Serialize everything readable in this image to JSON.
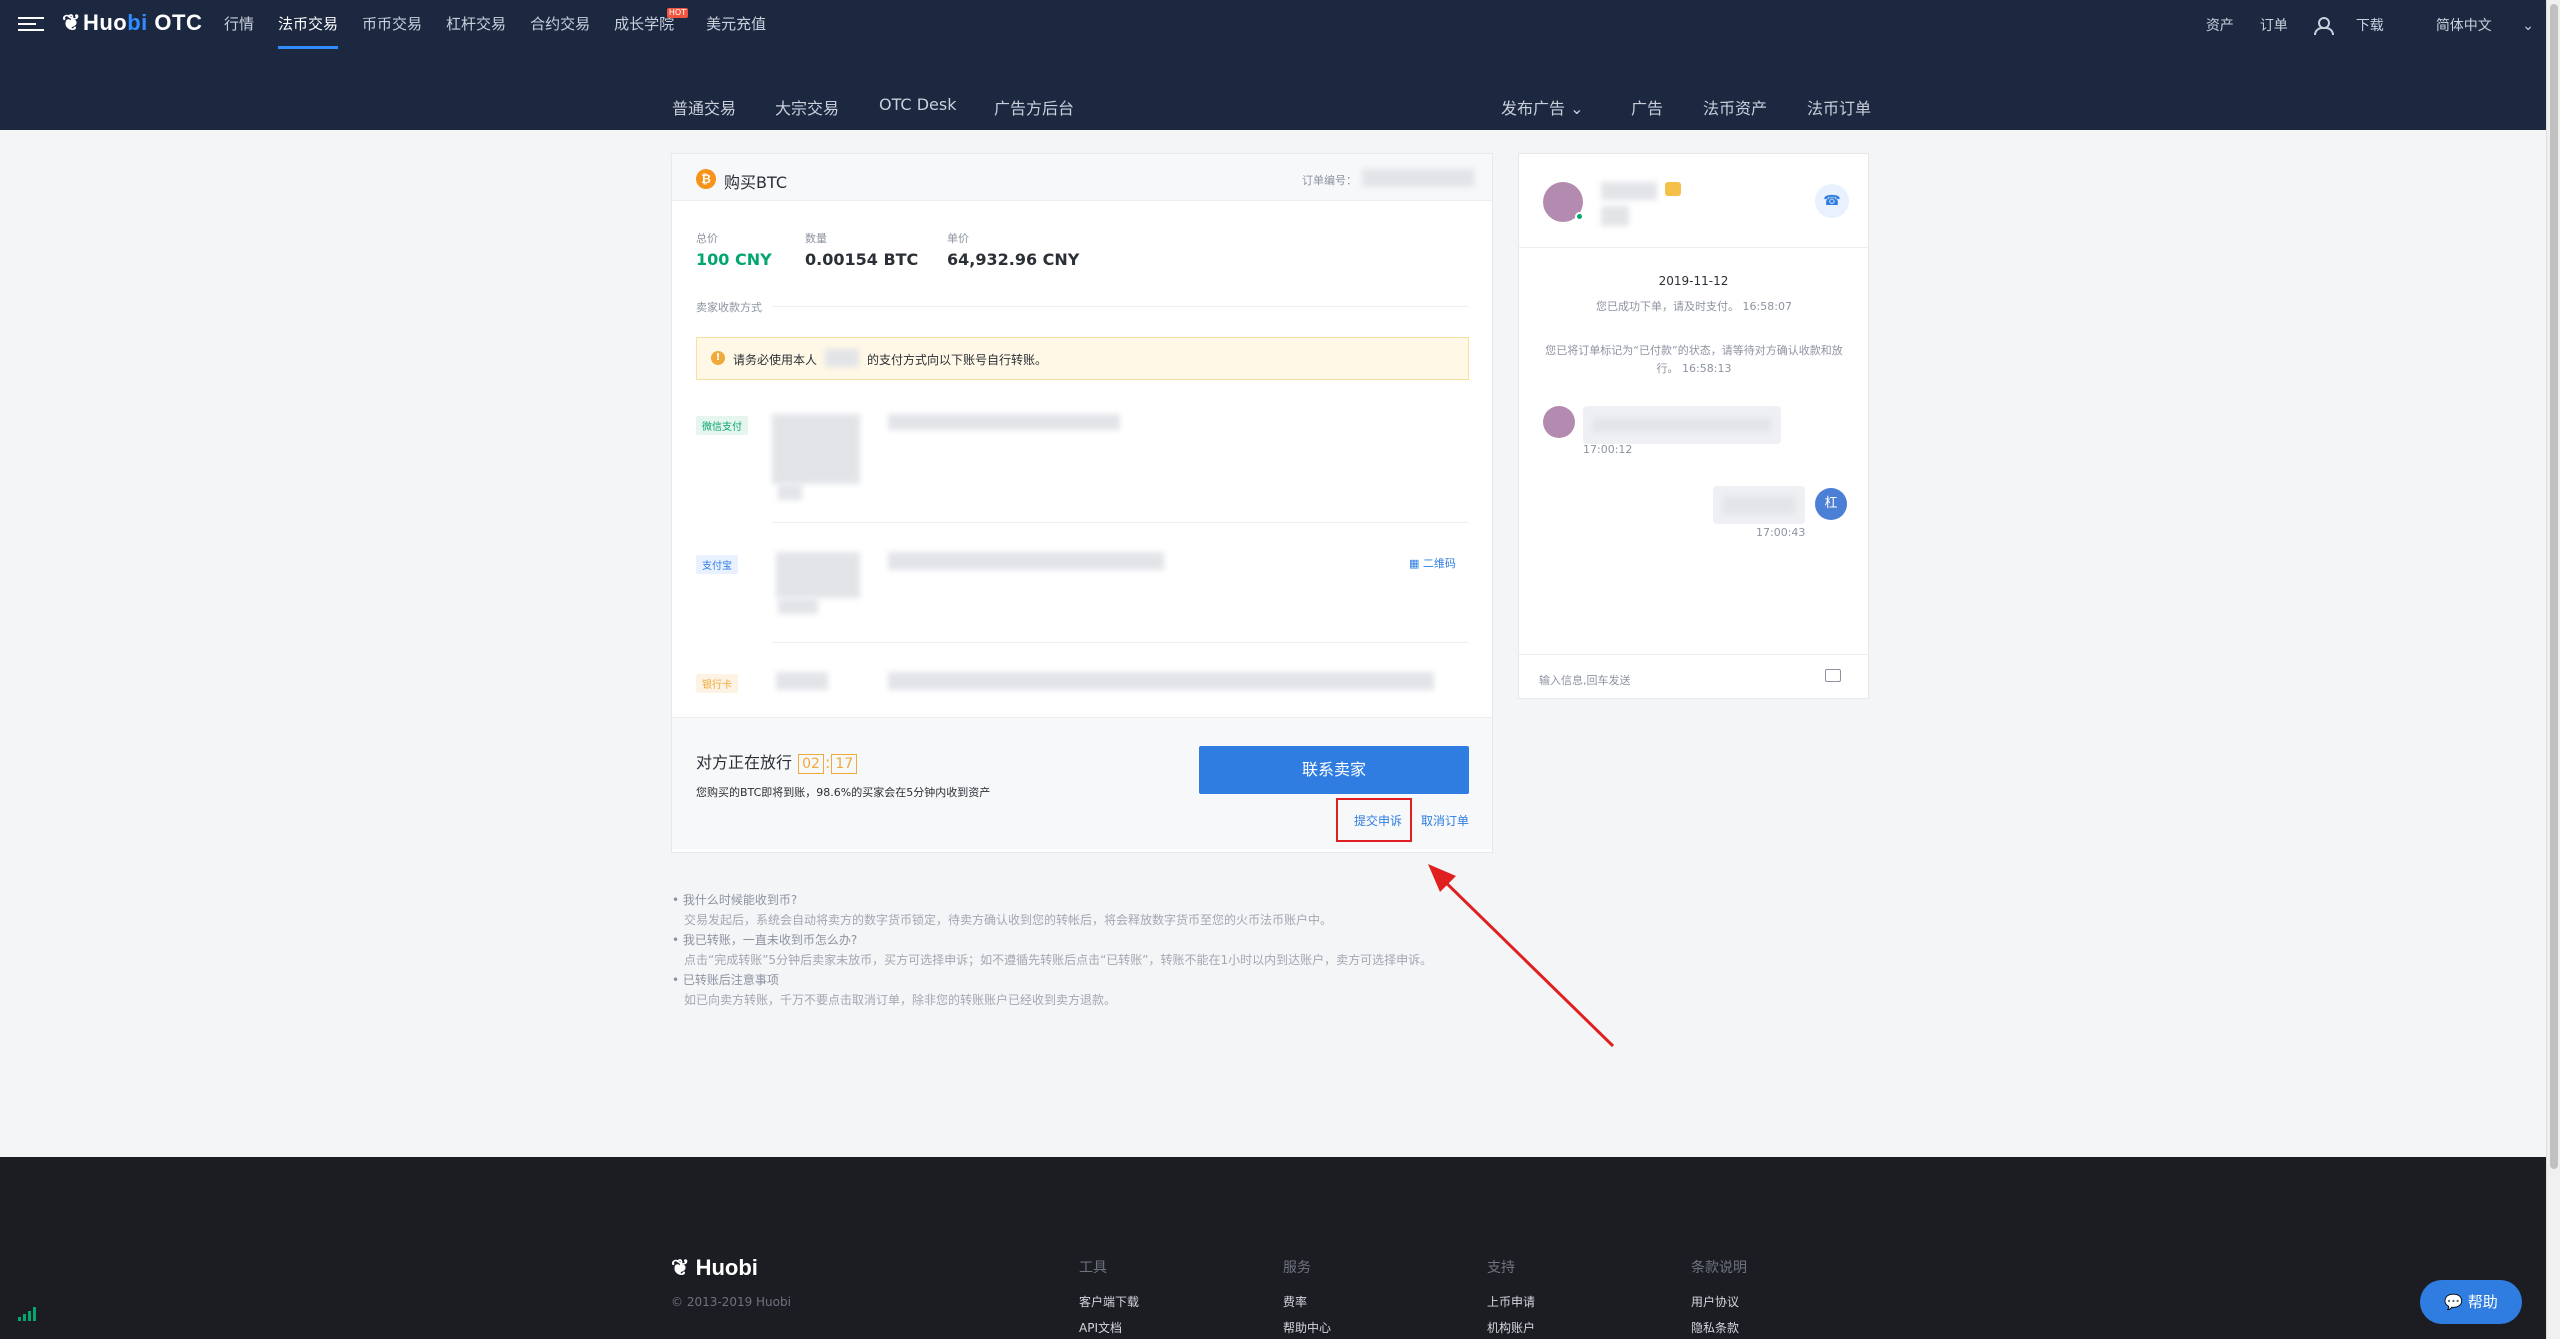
{
  "topnav": {
    "logo_main": "Huobi",
    "logo_accent": "bi",
    "logo_sub": "OTC",
    "menu": [
      "行情",
      "法币交易",
      "币币交易",
      "杠杆交易",
      "合约交易",
      "成长学院",
      "美元充值"
    ],
    "hot_badge": "HOT",
    "right": [
      "资产",
      "订单",
      "下载",
      "简体中文"
    ]
  },
  "subnav": {
    "left": [
      "普通交易",
      "大宗交易",
      "OTC Desk",
      "广告方后台"
    ],
    "right": [
      "发布广告",
      "广告",
      "法币资产",
      "法币订单"
    ]
  },
  "order": {
    "title": "购买BTC",
    "order_no_label": "订单编号：",
    "total_label": "总价",
    "total_value": "100 CNY",
    "qty_label": "数量",
    "qty_value": "0.00154 BTC",
    "price_label": "单价",
    "price_value": "64,932.96 CNY",
    "payee_methods_label": "卖家收款方式",
    "notice_prefix": "请务必使用本人",
    "notice_suffix": "的支付方式向以下账号自行转账。",
    "pay_wechat": "微信支付",
    "pay_alipay": "支付宝",
    "pay_bank": "银行卡",
    "qrcode_label": "二维码",
    "status_text": "对方正在放行",
    "timer_min": "02",
    "timer_sep": ":",
    "timer_sec": "17",
    "status_sub": "您购买的BTC即将到账，98.6%的买家会在5分钟内收到资产",
    "contact_button": "联系卖家",
    "appeal_link": "提交申诉",
    "cancel_link": "取消订单"
  },
  "faq": [
    {
      "q": "我什么时候能收到币?",
      "a": "交易发起后，系统会自动将卖方的数字货币锁定，待卖方确认收到您的转帐后，将会释放数字货币至您的火币法币账户中。"
    },
    {
      "q": "我已转账，一直未收到币怎么办?",
      "a": "点击“完成转账”5分钟后卖家未放币，买方可选择申诉；如不遵循先转账后点击“已转账”，转账不能在1小时以内到达账户，卖方可选择申诉。"
    },
    {
      "q": "已转账后注意事项",
      "a": "如已向卖方转账，千万不要点击取消订单，除非您的转账账户已经收到卖方退款。"
    }
  ],
  "chat": {
    "date": "2019-11-12",
    "sys1": "您已成功下单，请及时支付。 16:58:07",
    "sys2": "您已将订单标记为“已付款”的状态，请等待对方确认收款和放行。 16:58:13",
    "msg1_time": "17:00:12",
    "msg2_time": "17:00:43",
    "self_avatar": "杠",
    "input_placeholder": "输入信息,回车发送"
  },
  "footer": {
    "logo": "Huobi",
    "copyright": "© 2013-2019 Huobi",
    "columns": [
      {
        "title": "工具",
        "links": [
          "客户端下载",
          "API文档"
        ]
      },
      {
        "title": "服务",
        "links": [
          "费率",
          "帮助中心"
        ]
      },
      {
        "title": "支持",
        "links": [
          "上币申请",
          "机构账户"
        ]
      },
      {
        "title": "条款说明",
        "links": [
          "用户协议",
          "隐私条款"
        ]
      }
    ]
  },
  "help_button": "帮助",
  "colors": {
    "nav_bg": "#1b2840",
    "accent": "#2f7de1",
    "green": "#03a66d",
    "timer": "#f0a93b",
    "annotation": "#e02020"
  }
}
